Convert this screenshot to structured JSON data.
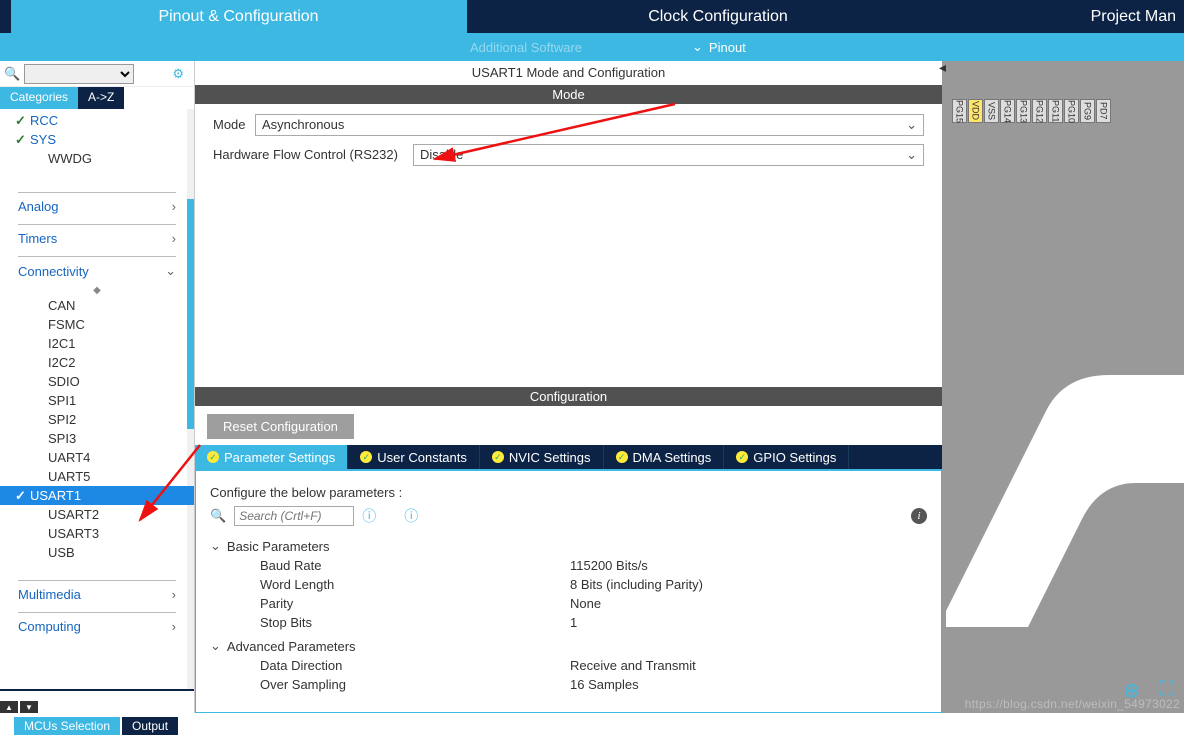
{
  "topTabs": {
    "pinout": "Pinout & Configuration",
    "clock": "Clock Configuration",
    "project": "Project Man"
  },
  "subBar": {
    "additional": "Additional Software",
    "pinout": "Pinout"
  },
  "leftPanel": {
    "catTab": "Categories",
    "azTab": "A->Z",
    "itemsTop": [
      {
        "label": "RCC",
        "checked": true
      },
      {
        "label": "SYS",
        "checked": true
      },
      {
        "label": "WWDG",
        "checked": false
      }
    ],
    "groupAnalog": "Analog",
    "groupTimers": "Timers",
    "groupConnectivity": "Connectivity",
    "connItems": [
      "CAN",
      "FSMC",
      "I2C1",
      "I2C2",
      "SDIO",
      "SPI1",
      "SPI2",
      "SPI3",
      "UART4",
      "UART5",
      "USART1",
      "USART2",
      "USART3",
      "USB"
    ],
    "selectedConn": "USART1",
    "groupMultimedia": "Multimedia",
    "groupComputing": "Computing"
  },
  "footer": {
    "mcus": "MCUs Selection",
    "output": "Output"
  },
  "center": {
    "title": "USART1 Mode and Configuration",
    "modeBar": "Mode",
    "modeLabel": "Mode",
    "modeValue": "Asynchronous",
    "hwLabel": "Hardware Flow Control (RS232)",
    "hwValue": "Disable",
    "configBar": "Configuration",
    "resetBtn": "Reset Configuration",
    "tabs": [
      "Parameter Settings",
      "User Constants",
      "NVIC Settings",
      "DMA Settings",
      "GPIO Settings"
    ],
    "paramHead": "Configure the below parameters :",
    "searchPlaceholder": "Search (Crtl+F)",
    "groups": [
      {
        "name": "Basic Parameters",
        "rows": [
          {
            "name": "Baud Rate",
            "val": "115200 Bits/s"
          },
          {
            "name": "Word Length",
            "val": "8 Bits (including Parity)"
          },
          {
            "name": "Parity",
            "val": "None"
          },
          {
            "name": "Stop Bits",
            "val": "1"
          }
        ]
      },
      {
        "name": "Advanced Parameters",
        "rows": [
          {
            "name": "Data Direction",
            "val": "Receive and Transmit"
          },
          {
            "name": "Over Sampling",
            "val": "16 Samples"
          }
        ]
      }
    ]
  },
  "pins": [
    "PG15",
    "VDD",
    "VSS",
    "PG14",
    "PG13",
    "PG12",
    "PG11",
    "PG10",
    "PG9",
    "PD7"
  ],
  "watermark": "https://blog.csdn.net/weixin_54973022"
}
